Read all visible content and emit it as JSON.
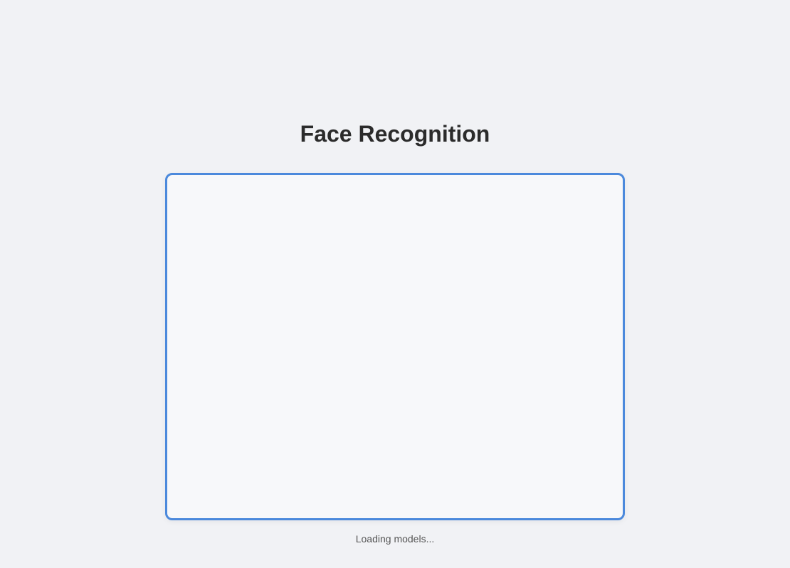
{
  "header": {
    "title": "Face Recognition"
  },
  "status": {
    "text": "Loading models..."
  }
}
